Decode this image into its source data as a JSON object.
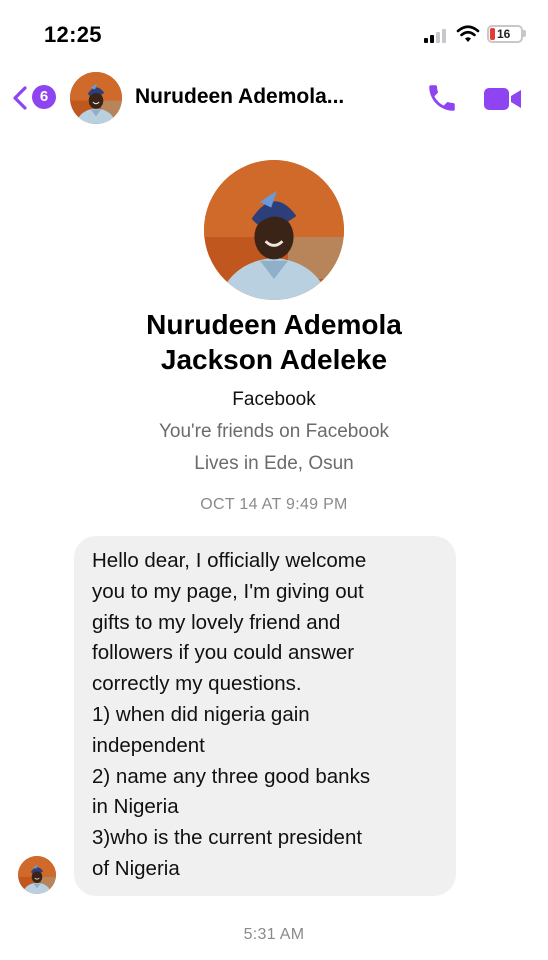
{
  "status_bar": {
    "time": "12:25",
    "battery_level": "16",
    "signal_bars_active": 2
  },
  "header": {
    "back_badge_count": "6",
    "contact_name": "Nurudeen Ademola...",
    "accent_color": "#8e44f0"
  },
  "profile": {
    "name_line1": "Nurudeen Ademola",
    "name_line2": "Jackson Adeleke",
    "platform": "Facebook",
    "friends_status": "You're friends on Facebook",
    "location": "Lives in Ede, Osun"
  },
  "conversation": {
    "first_timestamp": "OCT 14 AT 9:49 PM",
    "message_lines": [
      "Hello dear,  I officially welcome",
      "you to my page,  I'm giving out",
      "gifts to my lovely friend and",
      "followers if you could answer",
      "correctly my questions.",
      "1) when did nigeria gain",
      "independent",
      "2) name any three good banks",
      "in Nigeria",
      "3)who is the current president",
      "of Nigeria"
    ],
    "last_timestamp": "5:31 AM"
  },
  "icons": {
    "back": "chevron-left-icon",
    "call": "phone-icon",
    "video": "video-camera-icon",
    "wifi": "wifi-icon",
    "signal": "cellular-signal-icon",
    "battery": "battery-icon"
  }
}
